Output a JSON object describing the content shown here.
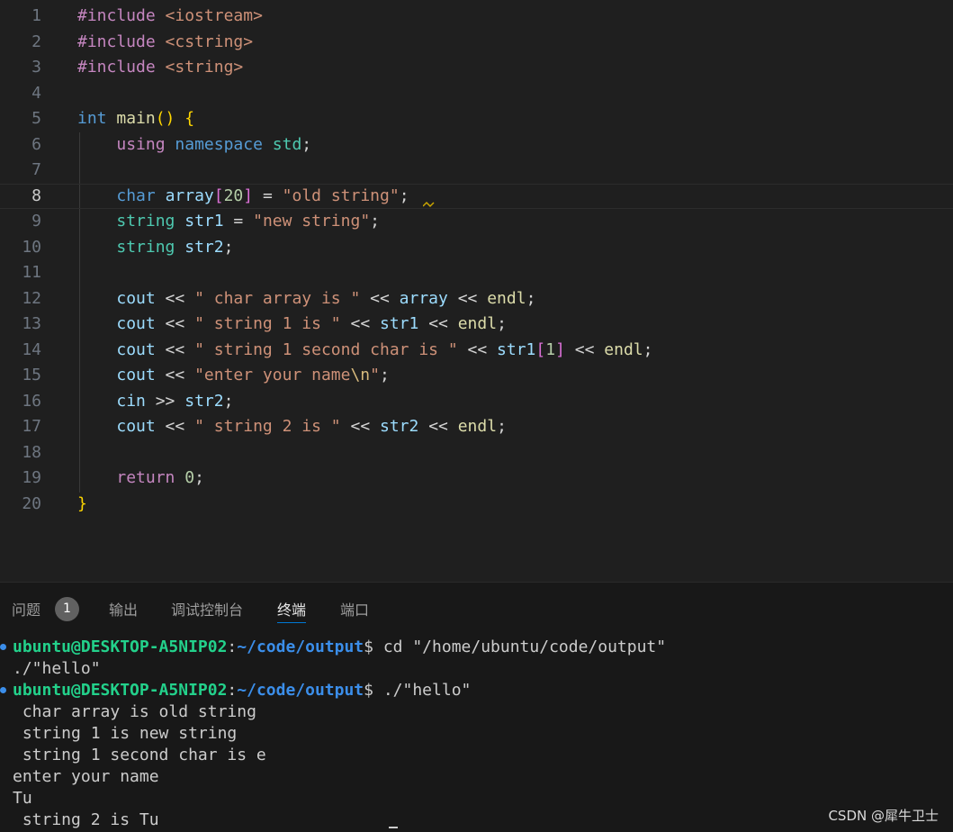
{
  "editor": {
    "language": "cpp",
    "active_line": 8,
    "lines": [
      {
        "number": "1",
        "tokens": [
          [
            "pre",
            "#include"
          ],
          [
            "op",
            " "
          ],
          [
            "inc",
            "<iostream>"
          ]
        ]
      },
      {
        "number": "2",
        "tokens": [
          [
            "pre",
            "#include"
          ],
          [
            "op",
            " "
          ],
          [
            "inc",
            "<cstring>"
          ]
        ]
      },
      {
        "number": "3",
        "tokens": [
          [
            "pre",
            "#include"
          ],
          [
            "op",
            " "
          ],
          [
            "inc",
            "<string>"
          ]
        ]
      },
      {
        "number": "4",
        "tokens": []
      },
      {
        "number": "5",
        "tokens": [
          [
            "kw",
            "int"
          ],
          [
            "op",
            " "
          ],
          [
            "fn",
            "main"
          ],
          [
            "p1",
            "()"
          ],
          [
            "op",
            " "
          ],
          [
            "p1",
            "{"
          ]
        ]
      },
      {
        "number": "6",
        "tokens": [
          [
            "op",
            "    "
          ],
          [
            "ctl",
            "using"
          ],
          [
            "op",
            " "
          ],
          [
            "kw",
            "namespace"
          ],
          [
            "op",
            " "
          ],
          [
            "typ",
            "std"
          ],
          [
            "op",
            ";"
          ]
        ]
      },
      {
        "number": "7",
        "tokens": []
      },
      {
        "number": "8",
        "tokens": [
          [
            "op",
            "    "
          ],
          [
            "kw",
            "char"
          ],
          [
            "op",
            " "
          ],
          [
            "var",
            "array"
          ],
          [
            "p2",
            "["
          ],
          [
            "num",
            "20"
          ],
          [
            "p2",
            "]"
          ],
          [
            "op",
            " = "
          ],
          [
            "str",
            "\"old string\""
          ],
          [
            "op",
            ";"
          ]
        ]
      },
      {
        "number": "9",
        "tokens": [
          [
            "op",
            "    "
          ],
          [
            "typ",
            "string"
          ],
          [
            "op",
            " "
          ],
          [
            "var",
            "str1"
          ],
          [
            "op",
            " = "
          ],
          [
            "str",
            "\"new string\""
          ],
          [
            "op",
            ";"
          ]
        ]
      },
      {
        "number": "10",
        "tokens": [
          [
            "op",
            "    "
          ],
          [
            "typ",
            "string"
          ],
          [
            "op",
            " "
          ],
          [
            "var",
            "str2"
          ],
          [
            "op",
            ";"
          ]
        ]
      },
      {
        "number": "11",
        "tokens": []
      },
      {
        "number": "12",
        "tokens": [
          [
            "op",
            "    "
          ],
          [
            "var",
            "cout"
          ],
          [
            "op",
            " << "
          ],
          [
            "str",
            "\" char array is \""
          ],
          [
            "op",
            " << "
          ],
          [
            "var",
            "array"
          ],
          [
            "op",
            " << "
          ],
          [
            "fn",
            "endl"
          ],
          [
            "op",
            ";"
          ]
        ]
      },
      {
        "number": "13",
        "tokens": [
          [
            "op",
            "    "
          ],
          [
            "var",
            "cout"
          ],
          [
            "op",
            " << "
          ],
          [
            "str",
            "\" string 1 is \""
          ],
          [
            "op",
            " << "
          ],
          [
            "var",
            "str1"
          ],
          [
            "op",
            " << "
          ],
          [
            "fn",
            "endl"
          ],
          [
            "op",
            ";"
          ]
        ]
      },
      {
        "number": "14",
        "tokens": [
          [
            "op",
            "    "
          ],
          [
            "var",
            "cout"
          ],
          [
            "op",
            " << "
          ],
          [
            "str",
            "\" string 1 second char is \""
          ],
          [
            "op",
            " << "
          ],
          [
            "var",
            "str1"
          ],
          [
            "p2",
            "["
          ],
          [
            "num",
            "1"
          ],
          [
            "p2",
            "]"
          ],
          [
            "op",
            " << "
          ],
          [
            "fn",
            "endl"
          ],
          [
            "op",
            ";"
          ]
        ]
      },
      {
        "number": "15",
        "tokens": [
          [
            "op",
            "    "
          ],
          [
            "var",
            "cout"
          ],
          [
            "op",
            " << "
          ],
          [
            "str",
            "\"enter your name"
          ],
          [
            "esc",
            "\\n"
          ],
          [
            "str",
            "\""
          ],
          [
            "op",
            ";"
          ]
        ]
      },
      {
        "number": "16",
        "tokens": [
          [
            "op",
            "    "
          ],
          [
            "var",
            "cin"
          ],
          [
            "op",
            " >> "
          ],
          [
            "var",
            "str2"
          ],
          [
            "op",
            ";"
          ]
        ]
      },
      {
        "number": "17",
        "tokens": [
          [
            "op",
            "    "
          ],
          [
            "var",
            "cout"
          ],
          [
            "op",
            " << "
          ],
          [
            "str",
            "\" string 2 is \""
          ],
          [
            "op",
            " << "
          ],
          [
            "var",
            "str2"
          ],
          [
            "op",
            " << "
          ],
          [
            "fn",
            "endl"
          ],
          [
            "op",
            ";"
          ]
        ]
      },
      {
        "number": "18",
        "tokens": []
      },
      {
        "number": "19",
        "tokens": [
          [
            "op",
            "    "
          ],
          [
            "ctl",
            "return"
          ],
          [
            "op",
            " "
          ],
          [
            "num",
            "0"
          ],
          [
            "op",
            ";"
          ]
        ]
      },
      {
        "number": "20",
        "tokens": [
          [
            "p1",
            "}"
          ]
        ]
      }
    ]
  },
  "panel": {
    "tabs": [
      {
        "label": "问题",
        "badge": "1",
        "active": false
      },
      {
        "label": "输出",
        "active": false
      },
      {
        "label": "调试控制台",
        "active": false
      },
      {
        "label": "终端",
        "active": true
      },
      {
        "label": "端口",
        "active": false
      }
    ]
  },
  "terminal": {
    "lines": [
      {
        "kind": "prompt",
        "user": "ubuntu@DESKTOP-A5NIP02",
        "sep": ":",
        "path": "~/code/output",
        "dollar": "$",
        "command": " cd \"/home/ubuntu/code/output\""
      },
      {
        "kind": "text",
        "text": "./\"hello\""
      },
      {
        "kind": "prompt",
        "user": "ubuntu@DESKTOP-A5NIP02",
        "sep": ":",
        "path": "~/code/output",
        "dollar": "$",
        "command": " ./\"hello\""
      },
      {
        "kind": "text",
        "text": " char array is old string"
      },
      {
        "kind": "text",
        "text": " string 1 is new string"
      },
      {
        "kind": "text",
        "text": " string 1 second char is e"
      },
      {
        "kind": "text",
        "text": "enter your name"
      },
      {
        "kind": "text",
        "text": "Tu"
      },
      {
        "kind": "text",
        "text": " string 2 is Tu"
      }
    ]
  },
  "watermark": "CSDN @犀牛卫士"
}
